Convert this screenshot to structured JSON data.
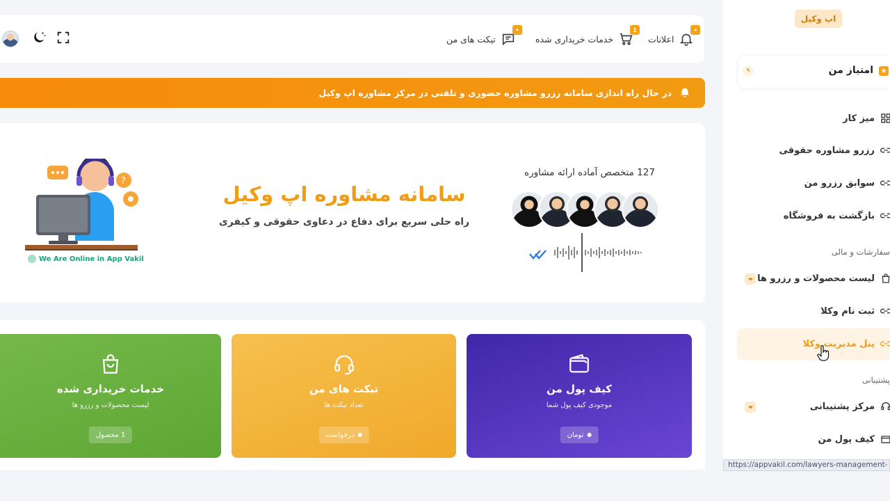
{
  "topbar": {
    "notifications": {
      "label": "اعلانات",
      "badge": "•",
      "icon": "bell-icon"
    },
    "purchased": {
      "label": "خدمات خریداری شده",
      "badge": "1",
      "icon": "cart-icon"
    },
    "tickets": {
      "label": "تیکت های من",
      "badge": "•",
      "icon": "chat-icon"
    },
    "fullscreen_icon": "fullscreen-icon",
    "theme_icon": "moon-icon",
    "avatar_icon": "user-avatar"
  },
  "banner": {
    "text": "در حال راه اندازی سامانه رزرو مشاوره حضوری و تلفنی در مرکز مشاوره اپ وکیل",
    "icon": "bell-icon",
    "color": "#f78b0a"
  },
  "hero": {
    "title": "سامانه مشاوره اپ وکیل",
    "subtitle": "راه حلی سریع برای دفاع در دعاوی حقوقی و کیفری",
    "experts_text": "127 متخصص آماده ارائه مشاوره",
    "online_text": "We Are Online in App Vakil"
  },
  "cards": [
    {
      "title": "کیف پول من",
      "subtitle": "موجودی کیف پول شما",
      "chip": "تومان",
      "icon": "wallet-icon",
      "color": "#4f2fb0"
    },
    {
      "title": "تیکت های من",
      "subtitle": "تعداد تیکت ها",
      "chip": "درخواست",
      "icon": "headset-icon",
      "color": "#f3b63c"
    },
    {
      "title": "خدمات خریداری شده",
      "subtitle": "لیست محصولات و رزرو ها",
      "chip": "1 محصول",
      "icon": "shopping-bag-icon",
      "color": "#6cb13f"
    }
  ],
  "sidebar": {
    "brand": "اپ وکیل",
    "points": {
      "label": "امتیاز من",
      "count": "۹"
    },
    "items": [
      {
        "label": "میز کار",
        "icon": "dashboard-icon"
      },
      {
        "label": "رزرو مشاوره حقوقی",
        "icon": "link-icon"
      },
      {
        "label": "سوابق رزرو من",
        "icon": "link-icon"
      },
      {
        "label": "بازگشت به فروشگاه",
        "icon": "link-icon"
      }
    ],
    "section_finance": "سفارشات و مالی",
    "finance_items": [
      {
        "label": "لیست محصولات و رزرو ها",
        "icon": "bag-icon"
      },
      {
        "label": "ثبت نام وکلا",
        "icon": "link-icon"
      },
      {
        "label": "پنل مدیریت وکلا",
        "icon": "link-icon"
      }
    ],
    "section_support": "پشتیبانی",
    "support_items": [
      {
        "label": "مرکز پشتیبانی",
        "icon": "headset-icon"
      },
      {
        "label": "کیف پول من",
        "icon": "wallet-icon"
      }
    ]
  },
  "status_url": "https://appvakil.com/lawyers-management-"
}
